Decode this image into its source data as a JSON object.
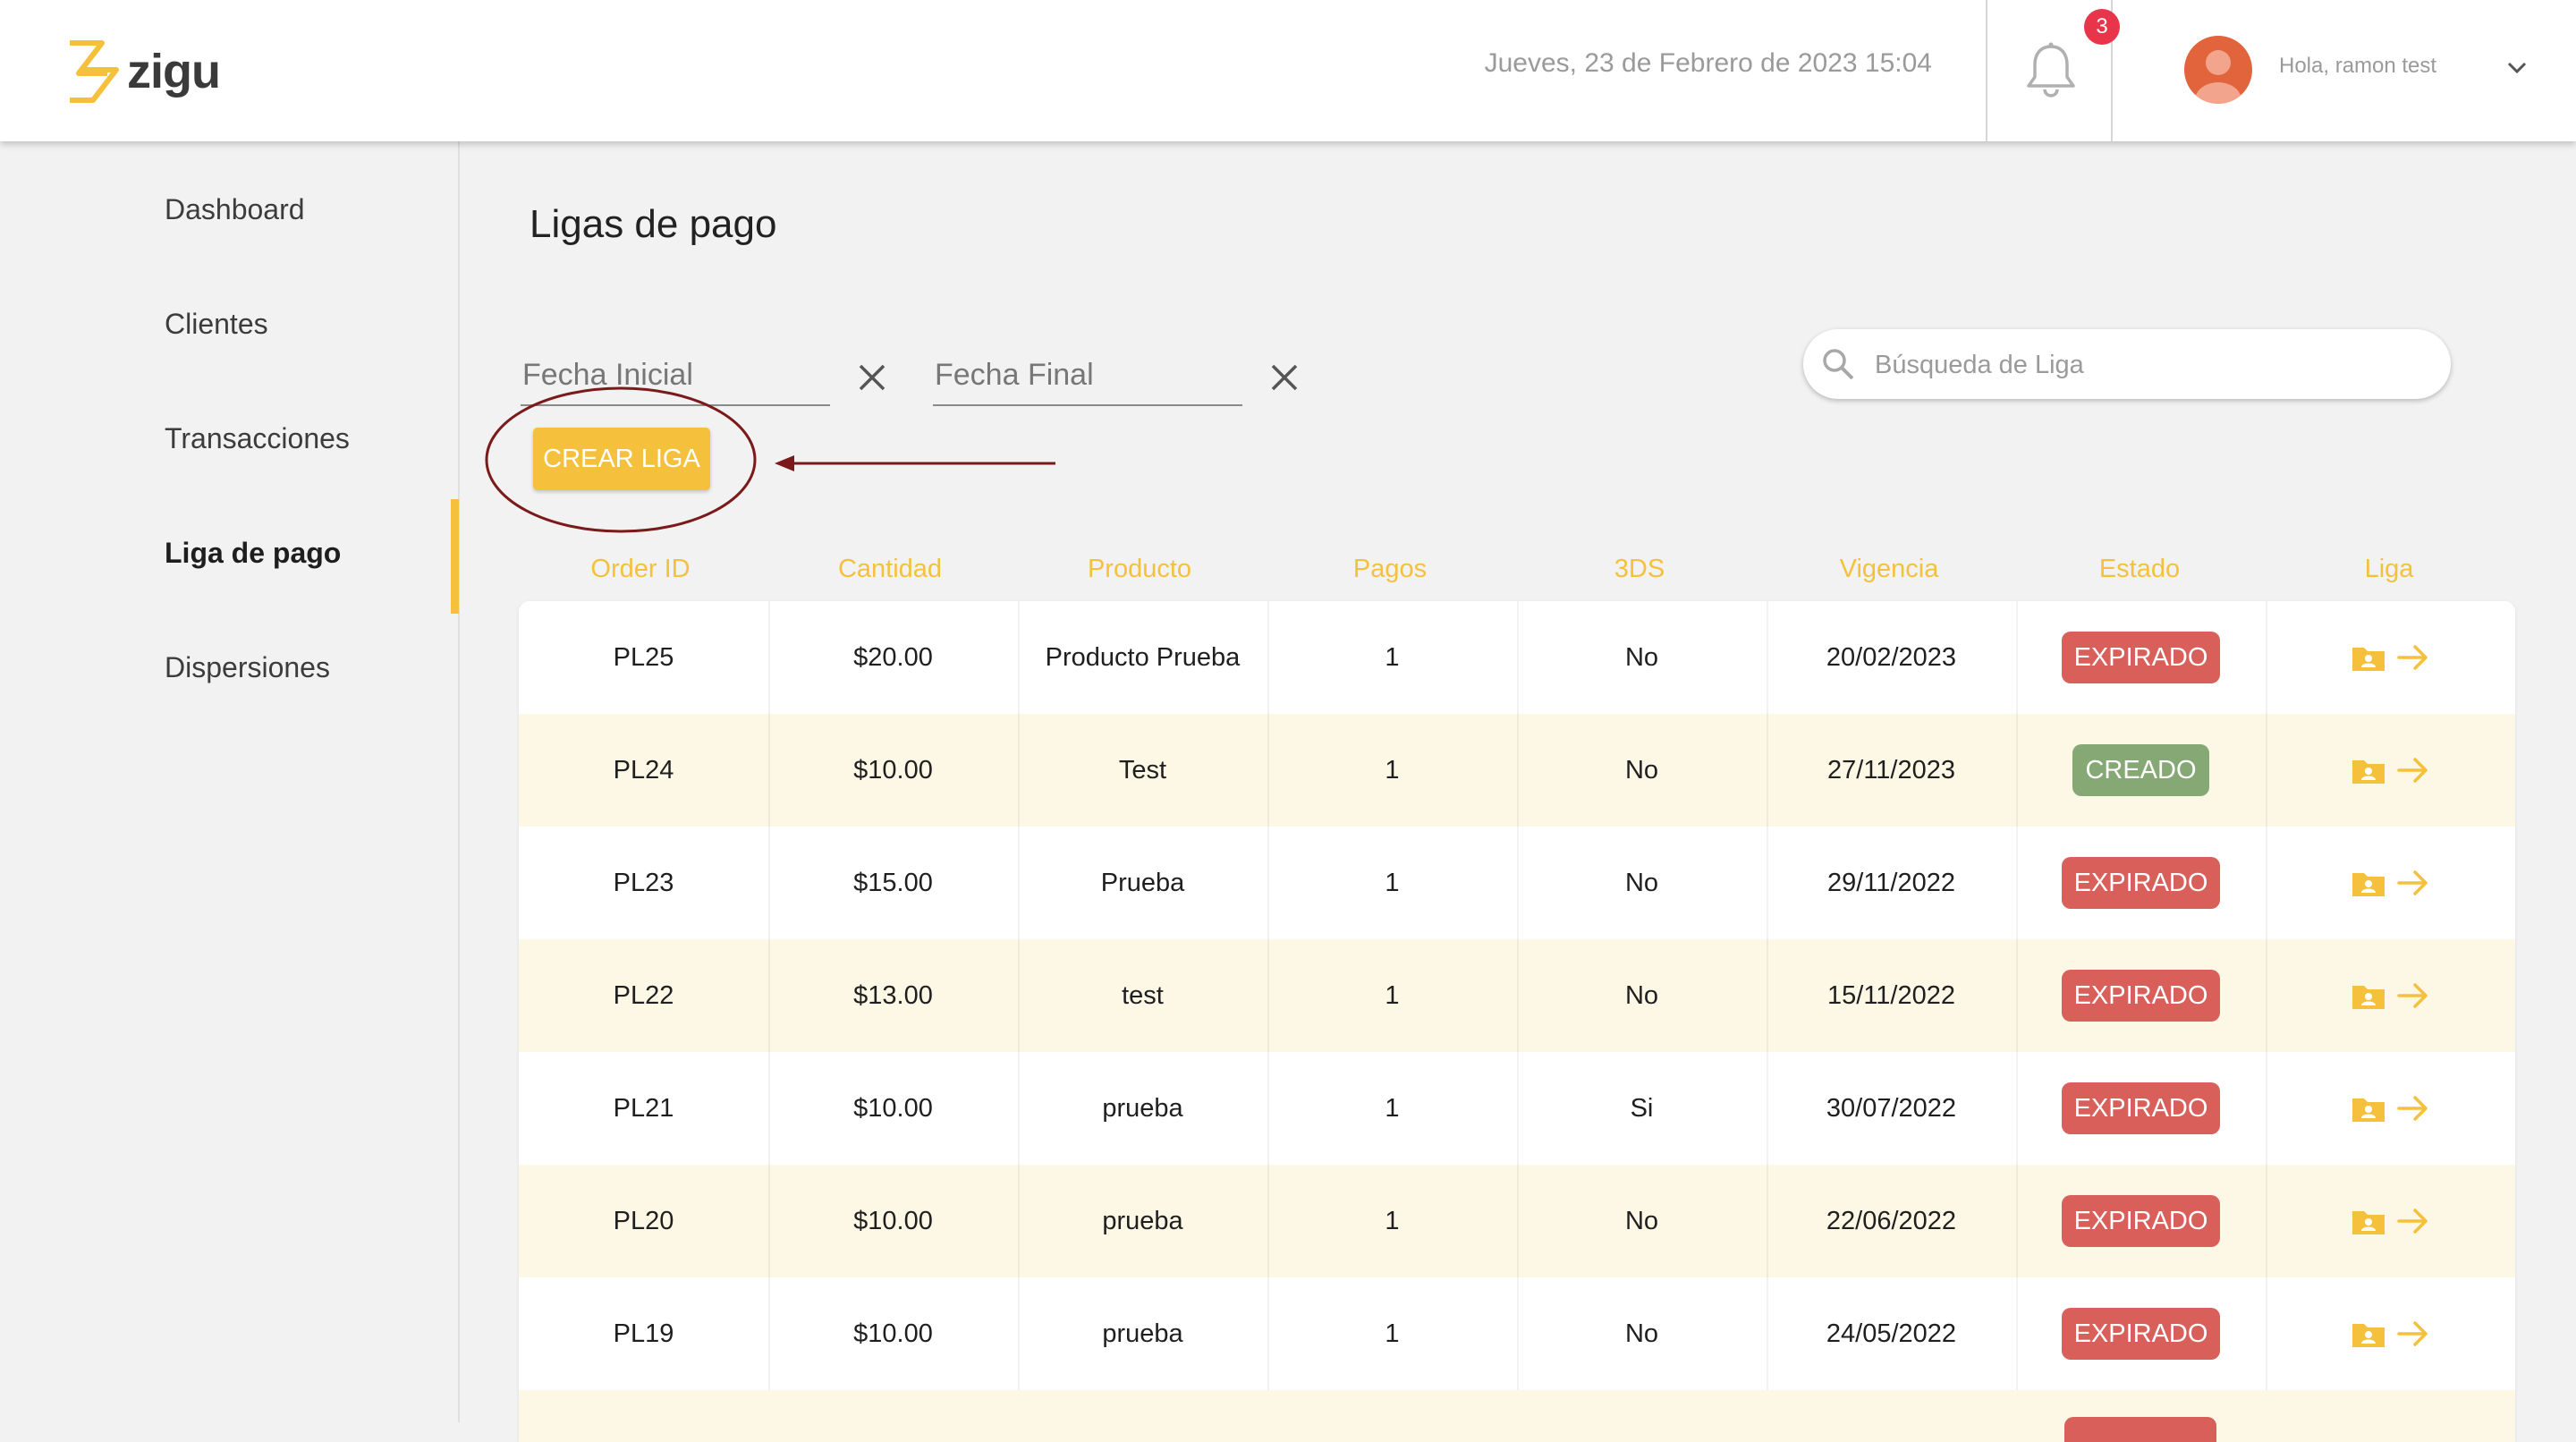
{
  "header": {
    "brand": "zigu",
    "datetime": "Jueves, 23 de Febrero de 2023 15:04",
    "notifications_count": "3",
    "greeting": "Hola, ramon test",
    "icons": [
      "logo",
      "bell-icon",
      "avatar",
      "chevron-down-icon"
    ]
  },
  "sidebar": {
    "items": [
      {
        "label": "Dashboard",
        "active": false
      },
      {
        "label": "Clientes",
        "active": false
      },
      {
        "label": "Transacciones",
        "active": false
      },
      {
        "label": "Liga de pago",
        "active": true
      },
      {
        "label": "Dispersiones",
        "active": false
      }
    ]
  },
  "main": {
    "title": "Ligas de pago",
    "filters": {
      "fecha_inicial_placeholder": "Fecha Inicial",
      "fecha_final_placeholder": "Fecha Final",
      "search_placeholder": "Búsqueda de Liga"
    },
    "create_button": "CREAR LIGA",
    "table": {
      "columns": [
        "Order ID",
        "Cantidad",
        "Producto",
        "Pagos",
        "3DS",
        "Vigencia",
        "Estado",
        "Liga"
      ],
      "rows": [
        {
          "order_id": "PL25",
          "cantidad": "$20.00",
          "producto": "Producto Prueba",
          "pagos": "1",
          "tds": "No",
          "vigencia": "20/02/2023",
          "estado": "EXPIRADO"
        },
        {
          "order_id": "PL24",
          "cantidad": "$10.00",
          "producto": "Test",
          "pagos": "1",
          "tds": "No",
          "vigencia": "27/11/2023",
          "estado": "CREADO"
        },
        {
          "order_id": "PL23",
          "cantidad": "$15.00",
          "producto": "Prueba",
          "pagos": "1",
          "tds": "No",
          "vigencia": "29/11/2022",
          "estado": "EXPIRADO"
        },
        {
          "order_id": "PL22",
          "cantidad": "$13.00",
          "producto": "test",
          "pagos": "1",
          "tds": "No",
          "vigencia": "15/11/2022",
          "estado": "EXPIRADO"
        },
        {
          "order_id": "PL21",
          "cantidad": "$10.00",
          "producto": "prueba",
          "pagos": "1",
          "tds": "Si",
          "vigencia": "30/07/2022",
          "estado": "EXPIRADO"
        },
        {
          "order_id": "PL20",
          "cantidad": "$10.00",
          "producto": "prueba",
          "pagos": "1",
          "tds": "No",
          "vigencia": "22/06/2022",
          "estado": "EXPIRADO"
        },
        {
          "order_id": "PL19",
          "cantidad": "$10.00",
          "producto": "prueba",
          "pagos": "1",
          "tds": "No",
          "vigencia": "24/05/2022",
          "estado": "EXPIRADO"
        }
      ]
    }
  },
  "colors": {
    "accent": "#f5c13d",
    "expirado": "#d9605a",
    "creado": "#86a874",
    "annotation": "#7a1a1a"
  }
}
